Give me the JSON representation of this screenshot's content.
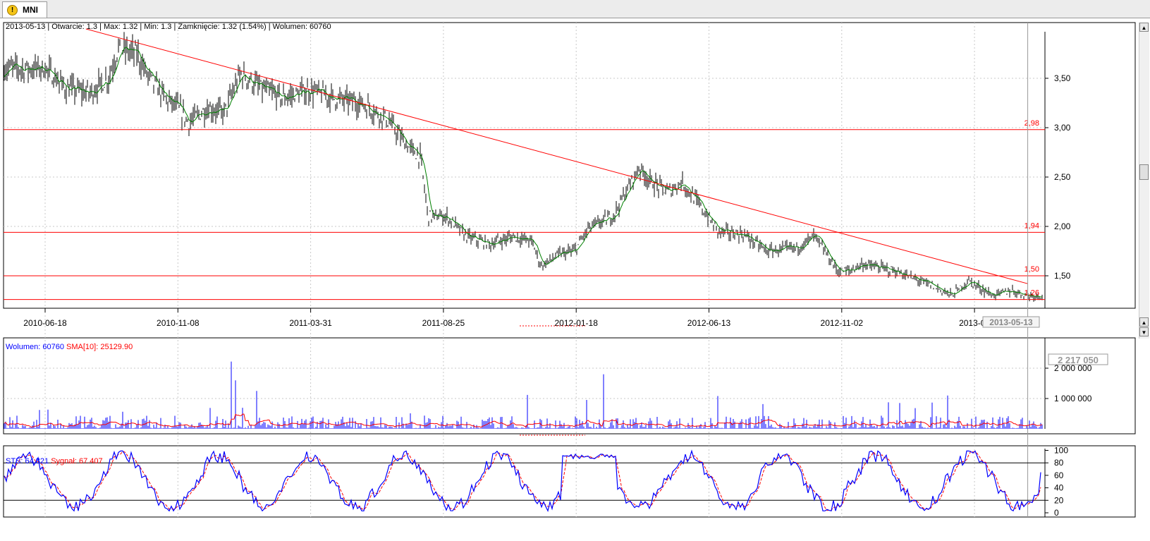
{
  "tab": {
    "label": "MNI",
    "icon": "warning-icon"
  },
  "price_info": "2013-05-13 | Otwarcie: 1.3 | Max: 1.32 | Min: 1.3 | Zamknięcie: 1.32 (1.54%)  | Wolumen: 60760",
  "volume_info": {
    "label": "Wolumen: 60760",
    "sma": "SMA[10]: 25129.90"
  },
  "sts_info": {
    "label": "STS: 64.821",
    "signal": "Sygnał: 67.407"
  },
  "cursor_date": "2013-05-13",
  "volume_max_label": "2 217 050",
  "colors": {
    "candles": "#000000",
    "sma": "#008000",
    "hlines": "#ff0000",
    "trend": "#ff0000",
    "volume": "#0000ff",
    "vol_sma": "#ff0000",
    "sts": "#0000ff",
    "signal": "#ff0000"
  },
  "chart_data": [
    {
      "type": "candlestick",
      "x_tick_labels": [
        "2010-06-18",
        "2010-11-08",
        "2011-03-31",
        "2011-08-25",
        "2012-01-18",
        "2012-06-13",
        "2012-11-02",
        "2013-04"
      ],
      "y_tick_labels": [
        "1,50",
        "2,00",
        "2,50",
        "3,00",
        "3,50"
      ],
      "ylim": [
        1.2,
        3.95
      ],
      "grid": true,
      "horizontal_levels": [
        {
          "value": 2.98,
          "label": "2,98"
        },
        {
          "value": 1.94,
          "label": "1,94"
        },
        {
          "value": 1.5,
          "label": "1,50"
        },
        {
          "value": 1.26,
          "label": "1,26"
        }
      ],
      "trend_line": [
        {
          "x": "2010-08-01",
          "y": 4.0
        },
        {
          "x": "2013-05-13",
          "y": 1.42
        }
      ],
      "price_path": [
        {
          "x": "2010-06-18",
          "y": 3.6
        },
        {
          "x": "2010-07-10",
          "y": 3.4
        },
        {
          "x": "2010-08-05",
          "y": 3.35
        },
        {
          "x": "2010-08-25",
          "y": 3.5
        },
        {
          "x": "2010-09-05",
          "y": 3.8
        },
        {
          "x": "2010-09-25",
          "y": 3.75
        },
        {
          "x": "2010-10-05",
          "y": 3.55
        },
        {
          "x": "2010-10-25",
          "y": 3.3
        },
        {
          "x": "2010-11-08",
          "y": 3.2
        },
        {
          "x": "2010-11-20",
          "y": 3.05
        },
        {
          "x": "2010-12-10",
          "y": 3.2
        },
        {
          "x": "2010-12-28",
          "y": 3.15
        },
        {
          "x": "2011-01-15",
          "y": 3.55
        },
        {
          "x": "2011-02-05",
          "y": 3.4
        },
        {
          "x": "2011-03-01",
          "y": 3.3
        },
        {
          "x": "2011-03-31",
          "y": 3.38
        },
        {
          "x": "2011-04-25",
          "y": 3.3
        },
        {
          "x": "2011-05-25",
          "y": 3.25
        },
        {
          "x": "2011-06-20",
          "y": 3.1
        },
        {
          "x": "2011-07-15",
          "y": 2.8
        },
        {
          "x": "2011-07-28",
          "y": 2.7
        },
        {
          "x": "2011-08-05",
          "y": 2.1
        },
        {
          "x": "2011-08-25",
          "y": 2.1
        },
        {
          "x": "2011-09-15",
          "y": 1.9
        },
        {
          "x": "2011-10-10",
          "y": 1.82
        },
        {
          "x": "2011-11-05",
          "y": 1.9
        },
        {
          "x": "2011-11-25",
          "y": 1.85
        },
        {
          "x": "2011-12-05",
          "y": 1.6
        },
        {
          "x": "2011-12-25",
          "y": 1.72
        },
        {
          "x": "2012-01-10",
          "y": 1.75
        },
        {
          "x": "2012-01-25",
          "y": 1.98
        },
        {
          "x": "2012-02-20",
          "y": 2.1
        },
        {
          "x": "2012-03-20",
          "y": 2.6
        },
        {
          "x": "2012-04-01",
          "y": 2.45
        },
        {
          "x": "2012-04-20",
          "y": 2.35
        },
        {
          "x": "2012-05-05",
          "y": 2.45
        },
        {
          "x": "2012-05-25",
          "y": 2.2
        },
        {
          "x": "2012-06-13",
          "y": 1.95
        },
        {
          "x": "2012-07-10",
          "y": 1.92
        },
        {
          "x": "2012-08-05",
          "y": 1.75
        },
        {
          "x": "2012-09-05",
          "y": 1.78
        },
        {
          "x": "2012-09-25",
          "y": 1.9
        },
        {
          "x": "2012-10-20",
          "y": 1.55
        },
        {
          "x": "2012-11-02",
          "y": 1.55
        },
        {
          "x": "2012-11-15",
          "y": 1.62
        },
        {
          "x": "2012-12-20",
          "y": 1.55
        },
        {
          "x": "2013-01-30",
          "y": 1.4
        },
        {
          "x": "2013-02-20",
          "y": 1.3
        },
        {
          "x": "2013-03-10",
          "y": 1.45
        },
        {
          "x": "2013-04-05",
          "y": 1.3
        },
        {
          "x": "2013-04-25",
          "y": 1.35
        },
        {
          "x": "2013-05-13",
          "y": 1.3
        }
      ]
    },
    {
      "type": "bar",
      "series": [
        {
          "name": "Wolumen",
          "values": "daily volume bars"
        },
        {
          "name": "SMA[10]"
        }
      ],
      "y_tick_labels": [
        "1 000 000",
        "2 000 000"
      ],
      "ylim": [
        0,
        2300000
      ],
      "max_value": 2217050,
      "spikes": [
        {
          "x": "2011-01-05",
          "value": 2217050
        },
        {
          "x": "2011-01-10",
          "value": 1600000
        },
        {
          "x": "2011-02-01",
          "value": 1250000
        },
        {
          "x": "2011-11-20",
          "value": 1120000
        },
        {
          "x": "2012-02-10",
          "value": 1800000
        },
        {
          "x": "2012-06-13",
          "value": 1080000
        },
        {
          "x": "2013-02-15",
          "value": 1100000
        }
      ]
    },
    {
      "type": "line",
      "series": [
        {
          "name": "STS"
        },
        {
          "name": "Sygnał"
        }
      ],
      "y_tick_labels": [
        "0",
        "20",
        "40",
        "60",
        "80",
        "100"
      ],
      "ylim": [
        0,
        100
      ],
      "levels": [
        20,
        80
      ],
      "last": {
        "sts": 64.821,
        "signal": 67.407
      }
    }
  ]
}
